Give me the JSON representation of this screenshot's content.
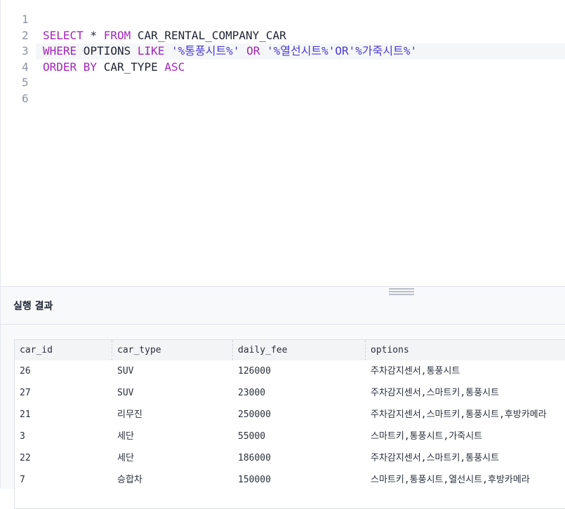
{
  "editor": {
    "lines": [
      {
        "number": "1",
        "tokens": []
      },
      {
        "number": "2",
        "tokens": [
          {
            "t": "SELECT",
            "c": "kw"
          },
          {
            "t": " * ",
            "c": "plain"
          },
          {
            "t": "FROM",
            "c": "kw"
          },
          {
            "t": " CAR_RENTAL_COMPANY_CAR",
            "c": "plain"
          }
        ]
      },
      {
        "number": "3",
        "active": true,
        "tokens": [
          {
            "t": "WHERE",
            "c": "kw"
          },
          {
            "t": " OPTIONS ",
            "c": "plain"
          },
          {
            "t": "LIKE",
            "c": "kw"
          },
          {
            "t": " '%통풍시트%' ",
            "c": "str"
          },
          {
            "t": "OR",
            "c": "kw"
          },
          {
            "t": " '%열선시트%'OR'%가죽시트%'",
            "c": "str"
          }
        ]
      },
      {
        "number": "4",
        "tokens": [
          {
            "t": "ORDER BY",
            "c": "kw"
          },
          {
            "t": " CAR_TYPE ",
            "c": "plain"
          },
          {
            "t": "ASC",
            "c": "kw"
          }
        ]
      },
      {
        "number": "5",
        "tokens": []
      },
      {
        "number": "6",
        "tokens": []
      }
    ]
  },
  "results": {
    "title": "실행 결과",
    "columns": [
      "car_id",
      "car_type",
      "daily_fee",
      "options"
    ],
    "rows": [
      [
        "26",
        "SUV",
        "126000",
        "주차감지센서,통풍시트"
      ],
      [
        "27",
        "SUV",
        "23000",
        "주차감지센서,스마트키,통풍시트"
      ],
      [
        "21",
        "리무진",
        "250000",
        "주차감지센서,스마트키,통풍시트,후방카메라"
      ],
      [
        "3",
        "세단",
        "55000",
        "스마트키,통풍시트,가죽시트"
      ],
      [
        "22",
        "세단",
        "186000",
        "주차감지센서,스마트키,통풍시트"
      ],
      [
        "7",
        "승합차",
        "150000",
        "스마트키,통풍시트,열선시트,후방카메라"
      ]
    ]
  }
}
